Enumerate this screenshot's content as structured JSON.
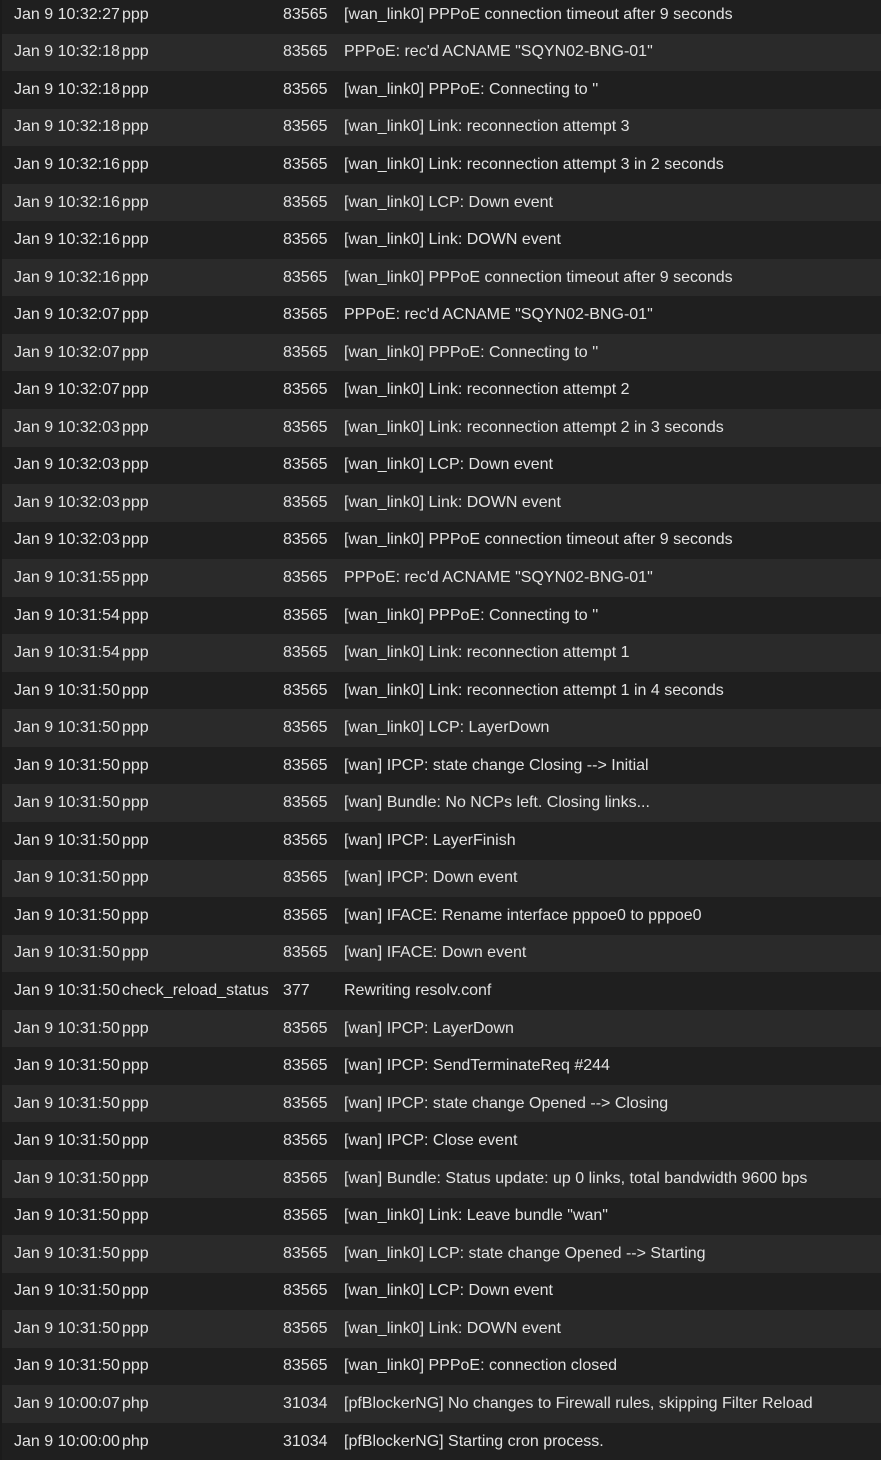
{
  "log": {
    "rows": [
      {
        "time": "Jan 9 10:32:27",
        "process": "ppp",
        "pid": "83565",
        "message": "[wan_link0] PPPoE connection timeout after 9 seconds"
      },
      {
        "time": "Jan 9 10:32:18",
        "process": "ppp",
        "pid": "83565",
        "message": "PPPoE: rec'd ACNAME \"SQYN02-BNG-01\""
      },
      {
        "time": "Jan 9 10:32:18",
        "process": "ppp",
        "pid": "83565",
        "message": "[wan_link0] PPPoE: Connecting to ''"
      },
      {
        "time": "Jan 9 10:32:18",
        "process": "ppp",
        "pid": "83565",
        "message": "[wan_link0] Link: reconnection attempt 3"
      },
      {
        "time": "Jan 9 10:32:16",
        "process": "ppp",
        "pid": "83565",
        "message": "[wan_link0] Link: reconnection attempt 3 in 2 seconds"
      },
      {
        "time": "Jan 9 10:32:16",
        "process": "ppp",
        "pid": "83565",
        "message": "[wan_link0] LCP: Down event"
      },
      {
        "time": "Jan 9 10:32:16",
        "process": "ppp",
        "pid": "83565",
        "message": "[wan_link0] Link: DOWN event"
      },
      {
        "time": "Jan 9 10:32:16",
        "process": "ppp",
        "pid": "83565",
        "message": "[wan_link0] PPPoE connection timeout after 9 seconds"
      },
      {
        "time": "Jan 9 10:32:07",
        "process": "ppp",
        "pid": "83565",
        "message": "PPPoE: rec'd ACNAME \"SQYN02-BNG-01\""
      },
      {
        "time": "Jan 9 10:32:07",
        "process": "ppp",
        "pid": "83565",
        "message": "[wan_link0] PPPoE: Connecting to ''"
      },
      {
        "time": "Jan 9 10:32:07",
        "process": "ppp",
        "pid": "83565",
        "message": "[wan_link0] Link: reconnection attempt 2"
      },
      {
        "time": "Jan 9 10:32:03",
        "process": "ppp",
        "pid": "83565",
        "message": "[wan_link0] Link: reconnection attempt 2 in 3 seconds"
      },
      {
        "time": "Jan 9 10:32:03",
        "process": "ppp",
        "pid": "83565",
        "message": "[wan_link0] LCP: Down event"
      },
      {
        "time": "Jan 9 10:32:03",
        "process": "ppp",
        "pid": "83565",
        "message": "[wan_link0] Link: DOWN event"
      },
      {
        "time": "Jan 9 10:32:03",
        "process": "ppp",
        "pid": "83565",
        "message": "[wan_link0] PPPoE connection timeout after 9 seconds"
      },
      {
        "time": "Jan 9 10:31:55",
        "process": "ppp",
        "pid": "83565",
        "message": "PPPoE: rec'd ACNAME \"SQYN02-BNG-01\""
      },
      {
        "time": "Jan 9 10:31:54",
        "process": "ppp",
        "pid": "83565",
        "message": "[wan_link0] PPPoE: Connecting to ''"
      },
      {
        "time": "Jan 9 10:31:54",
        "process": "ppp",
        "pid": "83565",
        "message": "[wan_link0] Link: reconnection attempt 1"
      },
      {
        "time": "Jan 9 10:31:50",
        "process": "ppp",
        "pid": "83565",
        "message": "[wan_link0] Link: reconnection attempt 1 in 4 seconds"
      },
      {
        "time": "Jan 9 10:31:50",
        "process": "ppp",
        "pid": "83565",
        "message": "[wan_link0] LCP: LayerDown"
      },
      {
        "time": "Jan 9 10:31:50",
        "process": "ppp",
        "pid": "83565",
        "message": "[wan] IPCP: state change Closing --> Initial"
      },
      {
        "time": "Jan 9 10:31:50",
        "process": "ppp",
        "pid": "83565",
        "message": "[wan] Bundle: No NCPs left. Closing links..."
      },
      {
        "time": "Jan 9 10:31:50",
        "process": "ppp",
        "pid": "83565",
        "message": "[wan] IPCP: LayerFinish"
      },
      {
        "time": "Jan 9 10:31:50",
        "process": "ppp",
        "pid": "83565",
        "message": "[wan] IPCP: Down event"
      },
      {
        "time": "Jan 9 10:31:50",
        "process": "ppp",
        "pid": "83565",
        "message": "[wan] IFACE: Rename interface pppoe0 to pppoe0"
      },
      {
        "time": "Jan 9 10:31:50",
        "process": "ppp",
        "pid": "83565",
        "message": "[wan] IFACE: Down event"
      },
      {
        "time": "Jan 9 10:31:50",
        "process": "check_reload_status",
        "pid": "377",
        "message": "Rewriting resolv.conf"
      },
      {
        "time": "Jan 9 10:31:50",
        "process": "ppp",
        "pid": "83565",
        "message": "[wan] IPCP: LayerDown"
      },
      {
        "time": "Jan 9 10:31:50",
        "process": "ppp",
        "pid": "83565",
        "message": "[wan] IPCP: SendTerminateReq #244"
      },
      {
        "time": "Jan 9 10:31:50",
        "process": "ppp",
        "pid": "83565",
        "message": "[wan] IPCP: state change Opened --> Closing"
      },
      {
        "time": "Jan 9 10:31:50",
        "process": "ppp",
        "pid": "83565",
        "message": "[wan] IPCP: Close event"
      },
      {
        "time": "Jan 9 10:31:50",
        "process": "ppp",
        "pid": "83565",
        "message": "[wan] Bundle: Status update: up 0 links, total bandwidth 9600 bps"
      },
      {
        "time": "Jan 9 10:31:50",
        "process": "ppp",
        "pid": "83565",
        "message": "[wan_link0] Link: Leave bundle \"wan\""
      },
      {
        "time": "Jan 9 10:31:50",
        "process": "ppp",
        "pid": "83565",
        "message": "[wan_link0] LCP: state change Opened --> Starting"
      },
      {
        "time": "Jan 9 10:31:50",
        "process": "ppp",
        "pid": "83565",
        "message": "[wan_link0] LCP: Down event"
      },
      {
        "time": "Jan 9 10:31:50",
        "process": "ppp",
        "pid": "83565",
        "message": "[wan_link0] Link: DOWN event"
      },
      {
        "time": "Jan 9 10:31:50",
        "process": "ppp",
        "pid": "83565",
        "message": "[wan_link0] PPPoE: connection closed"
      },
      {
        "time": "Jan 9 10:00:07",
        "process": "php",
        "pid": "31034",
        "message": "[pfBlockerNG] No changes to Firewall rules, skipping Filter Reload"
      },
      {
        "time": "Jan 9 10:00:00",
        "process": "php",
        "pid": "31034",
        "message": "[pfBlockerNG] Starting cron process."
      }
    ]
  }
}
